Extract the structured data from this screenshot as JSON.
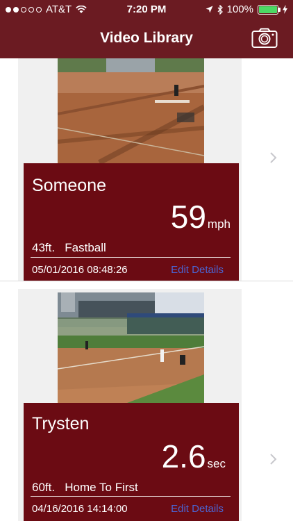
{
  "status_bar": {
    "carrier": "AT&T",
    "time": "7:20 PM",
    "battery": "100%"
  },
  "nav": {
    "title": "Video Library"
  },
  "videos": [
    {
      "name": "Someone",
      "value": "59",
      "unit": "mph",
      "distance": "43ft.",
      "type": "Fastball",
      "date": "05/01/2016 08:48:26",
      "edit_label": "Edit Details"
    },
    {
      "name": "Trysten",
      "value": "2.6",
      "unit": "sec",
      "distance": "60ft.",
      "type": "Home To First",
      "date": "04/16/2016 14:14:00",
      "edit_label": "Edit Details"
    }
  ],
  "colors": {
    "nav_background": "#6b1b22",
    "card_info_background": "#6b0b13",
    "edit_link": "#4b64d2"
  }
}
